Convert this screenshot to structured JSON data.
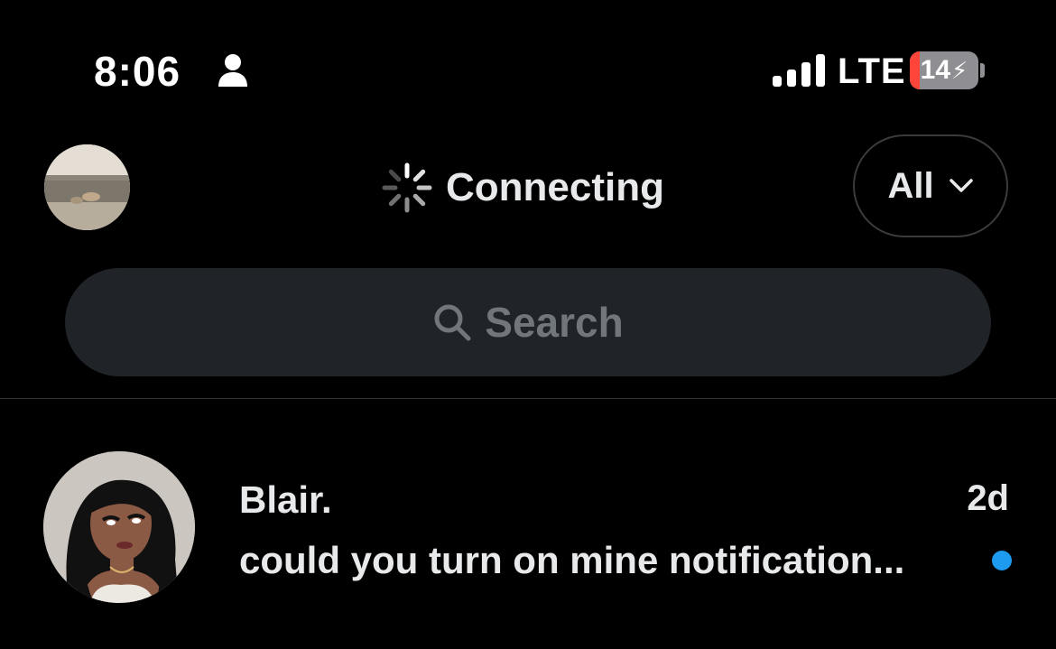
{
  "status_bar": {
    "time": "8:06",
    "network": "LTE",
    "battery_level": "14",
    "battery_fraction": 0.14,
    "battery_charging_icon": "bolt-icon",
    "focus_icon": "person-icon",
    "signal_icon": "cellular-signal-icon",
    "colors": {
      "battery_low": "#ff453a"
    }
  },
  "header": {
    "status_text": "Connecting",
    "status_icon": "loading-spinner-icon",
    "filter_label": "All",
    "filter_icon": "chevron-down-icon"
  },
  "search": {
    "placeholder": "Search",
    "icon": "search-icon"
  },
  "conversations": [
    {
      "name": "Blair.",
      "time": "2d",
      "preview": "could you turn on mine notification...",
      "unread": true,
      "unread_color": "#1d9bf0"
    }
  ],
  "theme": {
    "background": "#000000",
    "text": "#e7e9ea",
    "muted": "#71767b",
    "accent": "#1d9bf0",
    "search_bg": "#202327",
    "divider": "#2f3336"
  }
}
